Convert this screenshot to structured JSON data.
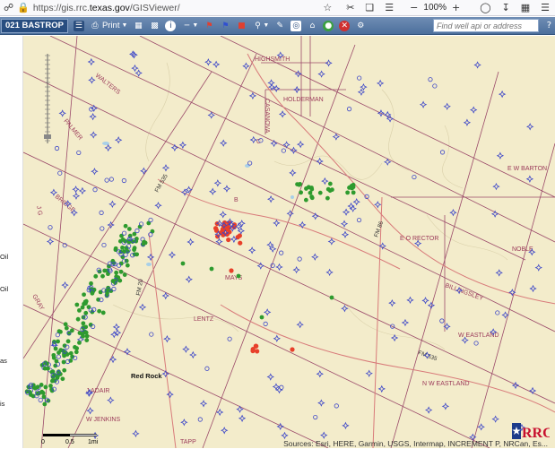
{
  "browser": {
    "url_prefix": "https://gis.rrc.",
    "url_domain": "texas.gov",
    "url_path": "/GISViewer/",
    "zoom": "100%"
  },
  "toolbar": {
    "county": "021 BASTROP",
    "print_label": "Print",
    "search_placeholder": "Find well api or address"
  },
  "side_labels": [
    "Oil",
    "Oil",
    "as",
    "is"
  ],
  "map": {
    "areas": [
      {
        "text": "WALTERS",
        "rotate": 38
      },
      {
        "text": "HIGHSMITH",
        "rotate": 0
      },
      {
        "text": "CASANOVA",
        "rotate": 90
      },
      {
        "text": "HOLDERMAN",
        "rotate": 0
      },
      {
        "text": "PALMER",
        "rotate": 50
      },
      {
        "text": "E W BARTON",
        "rotate": 0
      },
      {
        "text": "J G",
        "rotate": 80
      },
      {
        "text": "BRIDGE",
        "rotate": 40
      },
      {
        "text": "E O RECTOR",
        "rotate": 0
      },
      {
        "text": "NOBLE",
        "rotate": 0
      },
      {
        "text": "BILLINGSLEY",
        "rotate": 20
      },
      {
        "text": "MAYS",
        "rotate": 0
      },
      {
        "text": "LENTZ",
        "rotate": 0
      },
      {
        "text": "GRAY",
        "rotate": 60
      },
      {
        "text": "W EASTLAND",
        "rotate": 0
      },
      {
        "text": "N W EASTLAND",
        "rotate": 0
      },
      {
        "text": "J ADAIR",
        "rotate": 0
      },
      {
        "text": "W JENKINS",
        "rotate": 0
      },
      {
        "text": "TAPP",
        "rotate": 0
      },
      {
        "text": "C",
        "rotate": 0
      },
      {
        "text": "B",
        "rotate": 0
      }
    ],
    "roads": [
      "FM 535",
      "FM 20",
      "FM 535",
      "FM 86",
      "Red Rock"
    ],
    "scale": {
      "labels": [
        "0",
        "0.5",
        "1mi"
      ]
    },
    "attribution": "Sources: Esri, HERE, Garmin, USGS, Intermap, INCREMENT P, NRCan, Es..."
  },
  "colors": {
    "map_bg": "#f3eccb",
    "boundary": "#9b4a6a",
    "oil_well": "#2e9b2e",
    "permit": "#e8402a",
    "dry_hole": "#3c46c8"
  }
}
